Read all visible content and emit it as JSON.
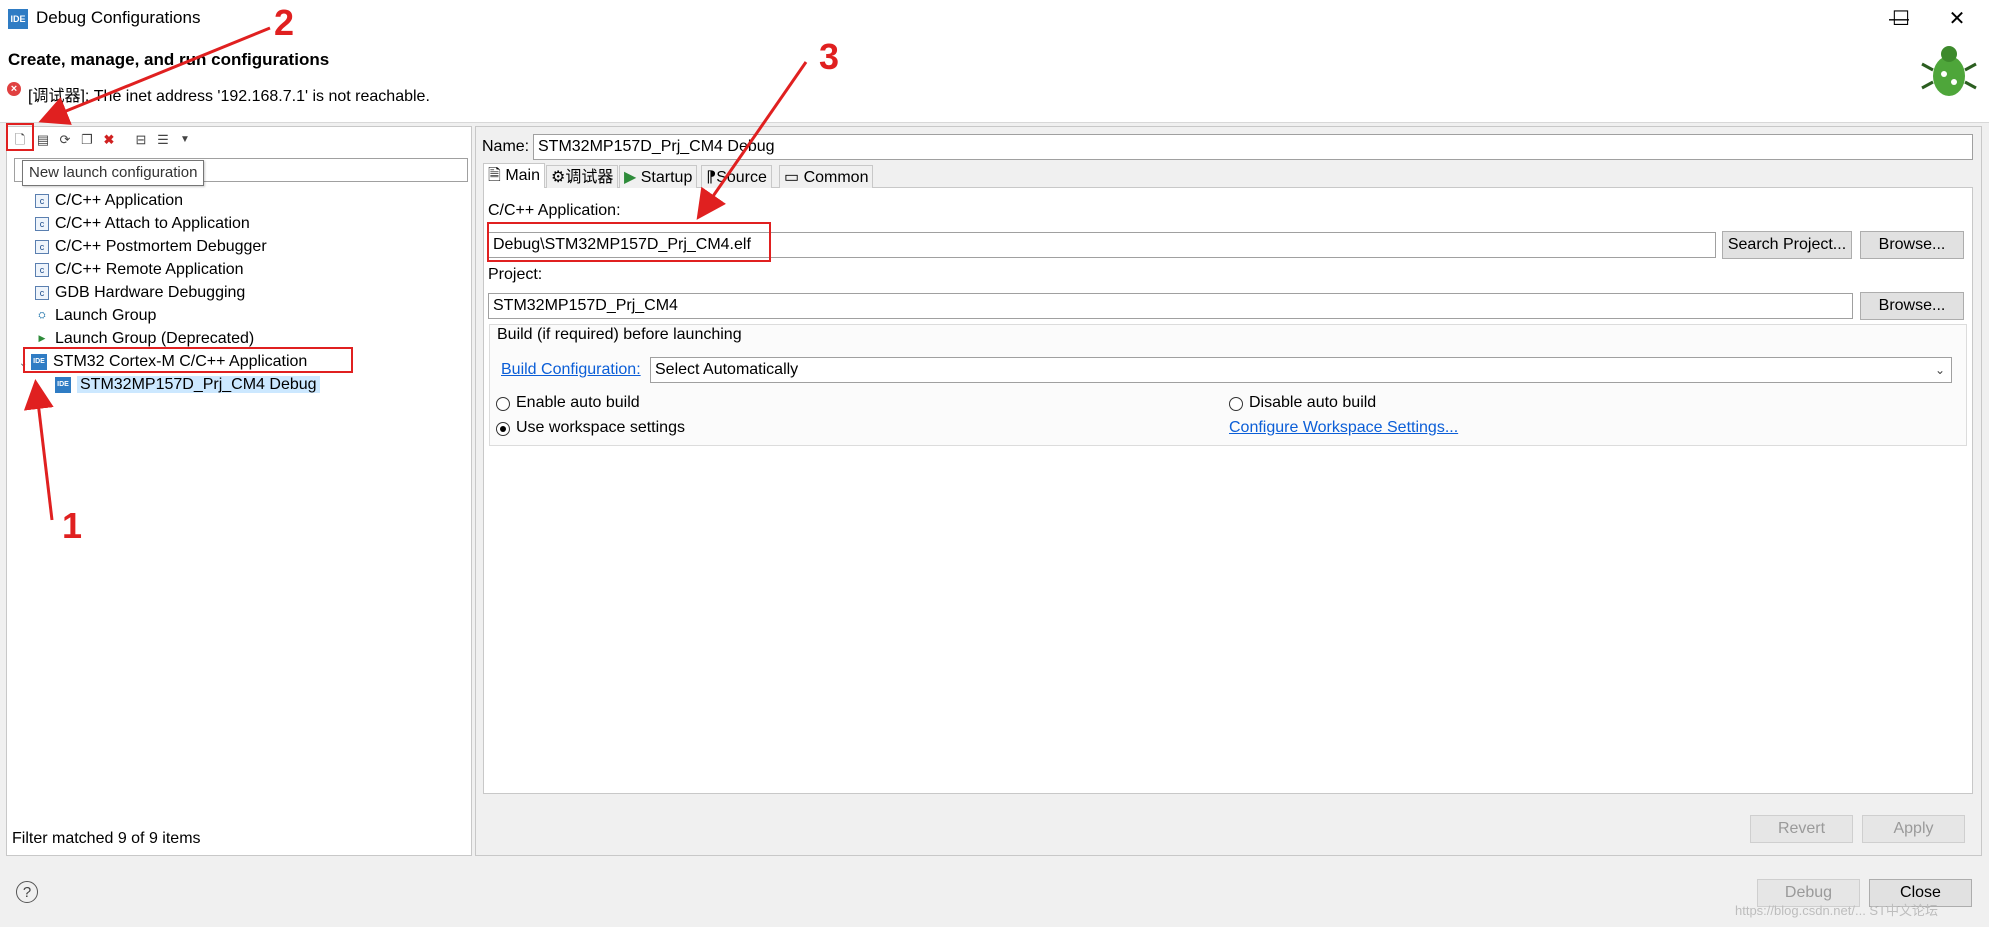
{
  "window": {
    "title": "Debug Configurations",
    "minimize": "—",
    "maximize": "☐",
    "close": "✕",
    "icon_text": "IDE"
  },
  "header": {
    "title": "Create, manage, and run configurations",
    "error": "[调试器]: The inet address '192.168.7.1' is not reachable."
  },
  "toolbar": {
    "buttons": [
      "new-launch-configuration",
      "new-prototype",
      "export",
      "duplicate",
      "delete",
      "collapse-all",
      "filter",
      "view-menu"
    ],
    "tooltip": "New launch configuration"
  },
  "tree": {
    "items": [
      "C/C++ Application",
      "C/C++ Attach to Application",
      "C/C++ Postmortem Debugger",
      "C/C++ Remote Application",
      "GDB Hardware Debugging",
      "Launch Group",
      "Launch Group (Deprecated)",
      "STM32 Cortex-M C/C++ Application",
      "STM32MP157D_Prj_CM4 Debug"
    ],
    "filter_status": "Filter matched 9 of 9 items"
  },
  "config": {
    "name_label": "Name:",
    "name_value": "STM32MP157D_Prj_CM4 Debug",
    "tabs": [
      "Main",
      "调试器",
      "Startup",
      "Source",
      "Common"
    ],
    "app_label": "C/C++ Application:",
    "app_value": "Debug\\STM32MP157D_Prj_CM4.elf",
    "search_project": "Search Project...",
    "browse": "Browse...",
    "project_label": "Project:",
    "project_value": "STM32MP157D_Prj_CM4",
    "build_group": "Build (if required) before launching",
    "build_config_label": "Build Configuration:",
    "build_config_value": "Select Automatically",
    "enable_auto": "Enable auto build",
    "disable_auto": "Disable auto build",
    "use_workspace": "Use workspace settings",
    "configure_workspace": "Configure Workspace Settings..."
  },
  "buttons": {
    "revert": "Revert",
    "apply": "Apply",
    "debug": "Debug",
    "close": "Close",
    "help": "?"
  },
  "annotations": {
    "n1": "1",
    "n2": "2",
    "n3": "3",
    "color": "#e02020"
  },
  "watermark": "https://blog.csdn.net/...  ST中文论坛"
}
